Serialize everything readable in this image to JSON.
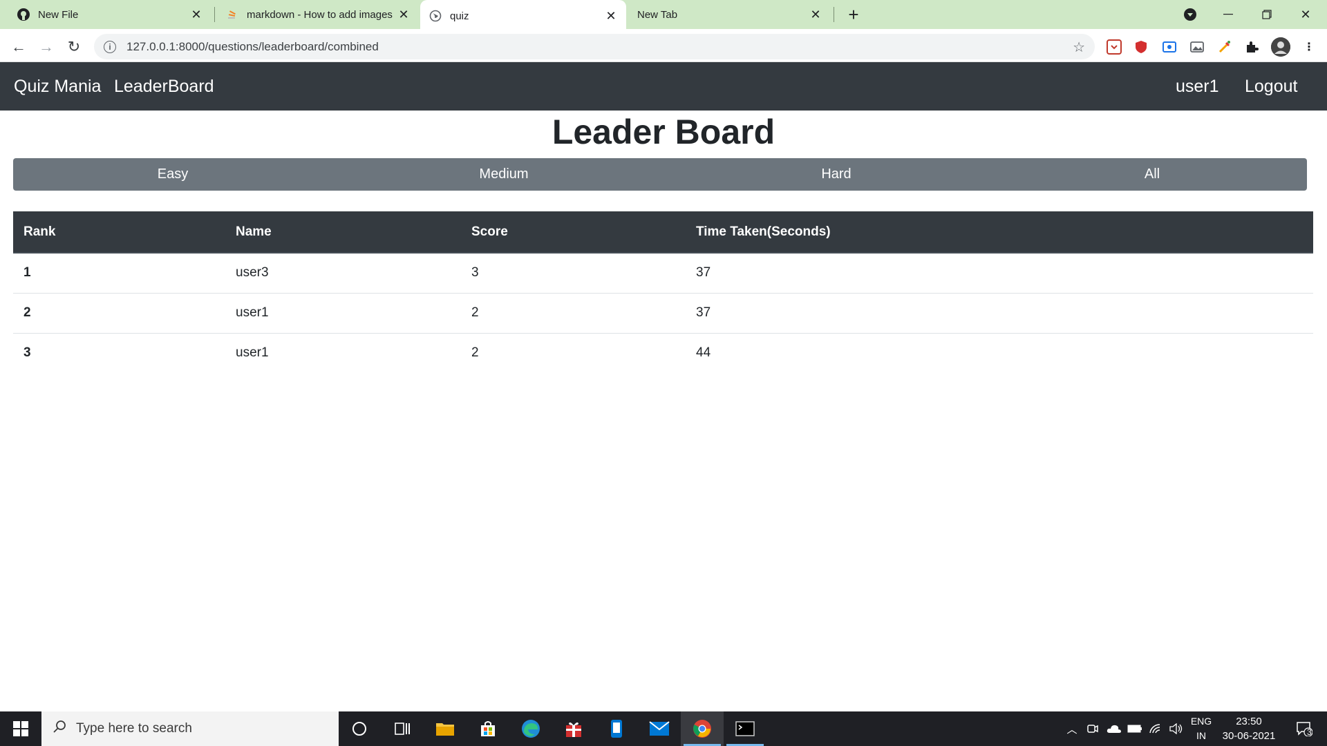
{
  "browser": {
    "tabs": [
      {
        "title": "New File",
        "favicon": "github-icon",
        "active": false
      },
      {
        "title": "markdown - How to add images",
        "favicon": "stackoverflow-icon",
        "active": false
      },
      {
        "title": "quiz",
        "favicon": "globe-icon",
        "active": true
      },
      {
        "title": "New Tab",
        "favicon": "",
        "active": false
      }
    ],
    "url": "127.0.0.1:8000/questions/leaderboard/combined"
  },
  "navbar": {
    "brand": "Quiz Mania",
    "leaderboard_link": "LeaderBoard",
    "username": "user1",
    "logout": "Logout"
  },
  "page": {
    "title": "Leader Board",
    "filters": [
      "Easy",
      "Medium",
      "Hard",
      "All"
    ]
  },
  "table": {
    "columns": [
      "Rank",
      "Name",
      "Score",
      "Time Taken(Seconds)"
    ],
    "rows": [
      {
        "rank": "1",
        "name": "user3",
        "score": "3",
        "time": "37"
      },
      {
        "rank": "2",
        "name": "user1",
        "score": "2",
        "time": "37"
      },
      {
        "rank": "3",
        "name": "user1",
        "score": "2",
        "time": "44"
      }
    ]
  },
  "taskbar": {
    "search_placeholder": "Type here to search",
    "lang_line1": "ENG",
    "lang_line2": "IN",
    "time": "23:50",
    "date": "30-06-2021",
    "notifications": "3"
  },
  "colors": {
    "navbar": "#343a40",
    "filter_bar": "#6c757d",
    "tabstrip": "#cfe8c6"
  }
}
